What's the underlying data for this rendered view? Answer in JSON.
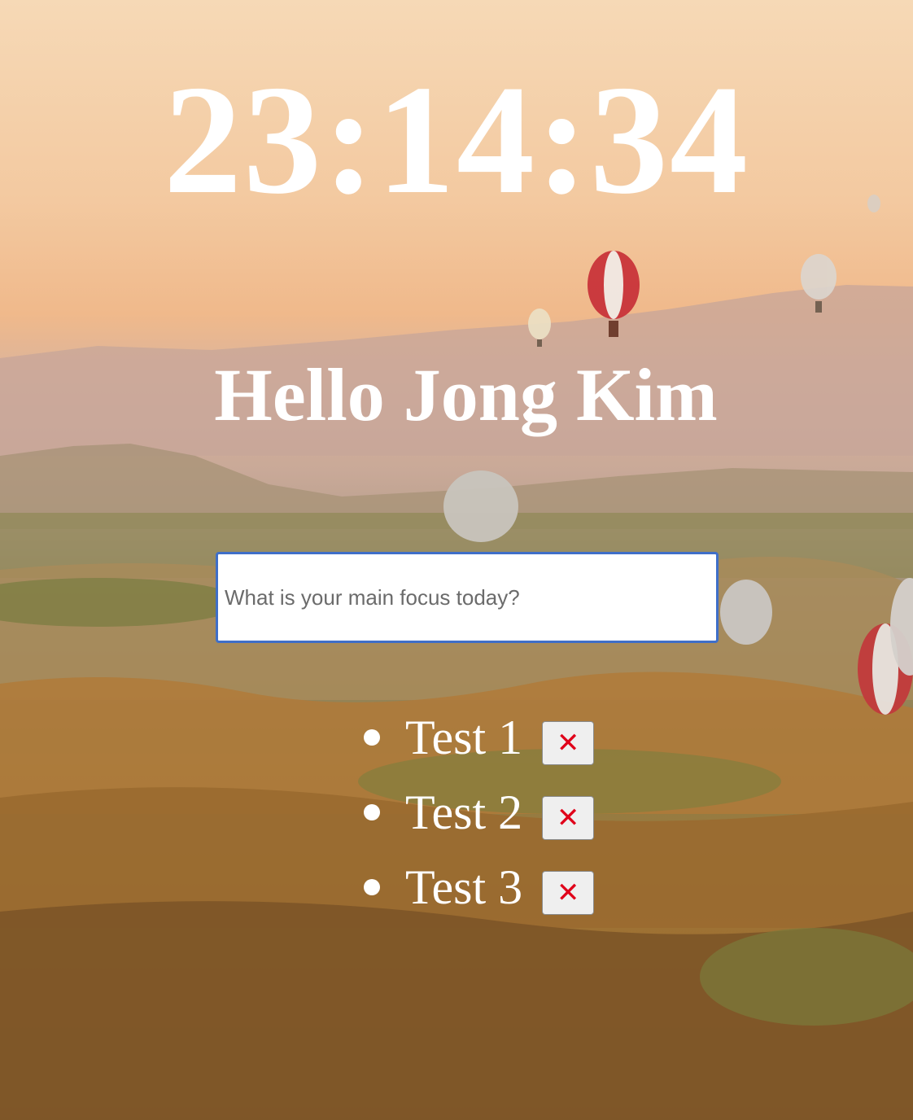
{
  "clock": {
    "time": "23:14:34"
  },
  "greeting": {
    "text": "Hello Jong Kim"
  },
  "focus": {
    "placeholder": "What is your main focus today?",
    "value": ""
  },
  "todos": [
    {
      "label": "Test 1",
      "delete_icon": "close-icon"
    },
    {
      "label": "Test 2",
      "delete_icon": "close-icon"
    },
    {
      "label": "Test 3",
      "delete_icon": "close-icon"
    }
  ],
  "colors": {
    "text": "#ffffff",
    "input_border": "#3f6fc8",
    "delete_icon": "#e0001a",
    "button_bg": "#efefef"
  }
}
